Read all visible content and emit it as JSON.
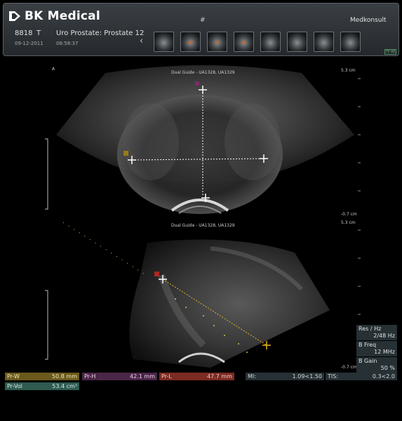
{
  "header": {
    "brand": "BK Medical",
    "patient_id": "8818",
    "patient_tag": "T",
    "exam": "Uro Prostate: Prostate 12",
    "date": "09-12-2011",
    "time": "08:58:37",
    "hash_label": "#",
    "user": "Medkonsult",
    "mini_label": "TP 8E"
  },
  "thumbnails": [
    {
      "icon": "ultrasound-thumbnail"
    },
    {
      "icon": "ultrasound-thumbnail-color"
    },
    {
      "icon": "ultrasound-thumbnail-color"
    },
    {
      "icon": "ultrasound-thumbnail-color"
    },
    {
      "icon": "ultrasound-thumbnail"
    },
    {
      "icon": "ultrasound-thumbnail"
    },
    {
      "icon": "ultrasound-thumbnail"
    },
    {
      "icon": "ultrasound-thumbnail"
    }
  ],
  "upper_image": {
    "title": "Dual Guide - UA1328, UA1329",
    "depth_top": "5.3 cm",
    "depth_bottom": "-0.7 cm",
    "orientation": "A"
  },
  "lower_image": {
    "title": "Dual Guide - UA1328, UA1329",
    "depth_top": "5.3 cm",
    "depth_bottom": "-0.7 cm"
  },
  "measurements": {
    "pr_w_label": "Pr-W",
    "pr_w_value": "50.8 mm",
    "pr_h_label": "Pr-H",
    "pr_h_value": "42.1 mm",
    "pr_l_label": "Pr-L",
    "pr_l_value": "47.7 mm",
    "pr_vol_label": "Pr-Vol",
    "pr_vol_value": "53.4 cm³"
  },
  "safety": {
    "mi_label": "MI:",
    "mi_value": "1.09<1.50",
    "tis_label": "TIS:",
    "tis_value": "0.3<2.0"
  },
  "parameters": [
    {
      "label": "Res / Hz",
      "value": "2/48 Hz"
    },
    {
      "label": "B Freq",
      "value": "12 MHz"
    },
    {
      "label": "B Gain",
      "value": "50 %"
    }
  ],
  "colors": {
    "pr_w": "#6b5a1b",
    "pr_h": "#4a2648",
    "pr_l": "#7a2b22",
    "pr_vol": "#2f5b51",
    "caliper_width": "#ffffff",
    "caliper_length": "#e6b020"
  }
}
